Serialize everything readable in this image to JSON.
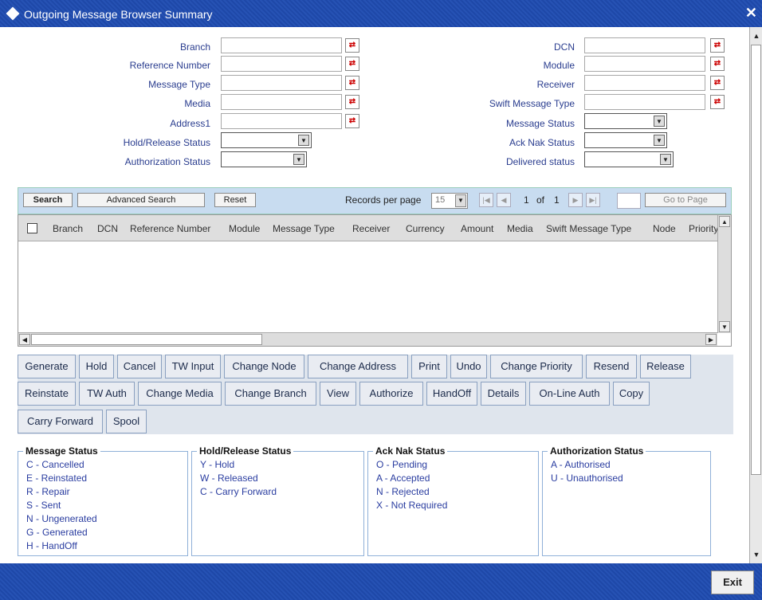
{
  "window": {
    "title": "Outgoing Message Browser Summary",
    "close_label": "✕"
  },
  "form": {
    "left": [
      {
        "label": "Branch"
      },
      {
        "label": "Reference Number"
      },
      {
        "label": "Message Type"
      },
      {
        "label": "Media"
      },
      {
        "label": "Address1"
      },
      {
        "label": "Hold/Release Status"
      },
      {
        "label": "Authorization Status"
      }
    ],
    "right": [
      {
        "label": "DCN"
      },
      {
        "label": "Module"
      },
      {
        "label": "Receiver"
      },
      {
        "label": "Swift Message Type"
      },
      {
        "label": "Message Status"
      },
      {
        "label": "Ack Nak Status"
      },
      {
        "label": "Delivered status"
      }
    ]
  },
  "search_bar": {
    "search": "Search",
    "advanced_search": "Advanced Search",
    "reset": "Reset",
    "records_per_page_label": "Records per page",
    "records_per_page_value": "15",
    "page_current": "1",
    "page_of": "of",
    "page_total": "1",
    "go_to_page": "Go to Page"
  },
  "grid": {
    "columns": [
      "Branch",
      "DCN",
      "Reference Number",
      "Module",
      "Message Type",
      "Receiver",
      "Currency",
      "Amount",
      "Media",
      "Swift Message Type",
      "Node",
      "Priority"
    ]
  },
  "actions": {
    "row1": [
      "Generate",
      "Hold",
      "Cancel",
      "TW Input",
      "Change Node",
      "Change Address",
      "Print",
      "Undo",
      "Change Priority",
      "Resend",
      "Release"
    ],
    "row2": [
      "Reinstate",
      "TW Auth",
      "Change Media",
      "Change Branch",
      "View",
      "Authorize",
      "HandOff",
      "Details",
      "On-Line Auth",
      "Copy"
    ],
    "row3": [
      "Carry Forward",
      "Spool"
    ]
  },
  "legends": {
    "message_status": {
      "title": "Message Status",
      "items": [
        "C - Cancelled",
        "E - Reinstated",
        "R - Repair",
        "S - Sent",
        "N - Ungenerated",
        "G - Generated",
        "H - HandOff"
      ]
    },
    "hold_release_status": {
      "title": "Hold/Release Status",
      "items": [
        "Y - Hold",
        "W - Released",
        "C - Carry Forward"
      ]
    },
    "ack_nak_status": {
      "title": "Ack Nak Status",
      "items": [
        "O - Pending",
        "A - Accepted",
        "N - Rejected",
        "X - Not Required"
      ]
    },
    "authorization_status": {
      "title": "Authorization Status",
      "items": [
        "A - Authorised",
        "U - Unauthorised"
      ]
    }
  },
  "footer": {
    "exit": "Exit"
  }
}
